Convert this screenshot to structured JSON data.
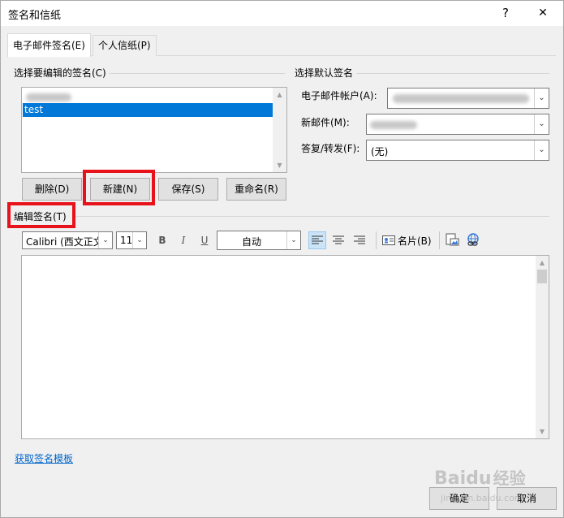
{
  "window": {
    "title": "签名和信纸",
    "help_label": "?",
    "close_label": "✕"
  },
  "tabs": [
    {
      "label": "电子邮件签名(E)",
      "active": true
    },
    {
      "label": "个人信纸(P)",
      "active": false
    }
  ],
  "select_signature": {
    "label": "选择要编辑的签名(C)",
    "items": [
      {
        "label": "",
        "selected": false
      },
      {
        "label": "test",
        "selected": true
      }
    ],
    "up_arrow": "▲",
    "down_arrow": "▼"
  },
  "signature_buttons": {
    "delete": "删除(D)",
    "new": "新建(N)",
    "save": "保存(S)",
    "rename": "重命名(R)"
  },
  "default_signature": {
    "label": "选择默认签名",
    "account_label": "电子邮件帐户(A):",
    "account_value": "",
    "new_messages_label": "新邮件(M):",
    "new_messages_value": "",
    "replies_label": "答复/转发(F):",
    "replies_value": "(无)",
    "dropdown_glyph": "⌄"
  },
  "edit_signature": {
    "label": "编辑签名(T)",
    "font": "Calibri (西文正文",
    "size": "11",
    "bold": "B",
    "italic": "I",
    "underline": "U",
    "color": "自动",
    "business_card": "名片(B)"
  },
  "template_link": "获取签名模板",
  "footer": {
    "ok": "确定",
    "cancel": "取消"
  },
  "watermark": {
    "brand": "Baidu",
    "brand_cn": "经验",
    "url": "jingyan.baidu.com"
  },
  "colors": {
    "highlight": "#e8121a",
    "selection": "#0078d7",
    "link": "#0066cc"
  }
}
